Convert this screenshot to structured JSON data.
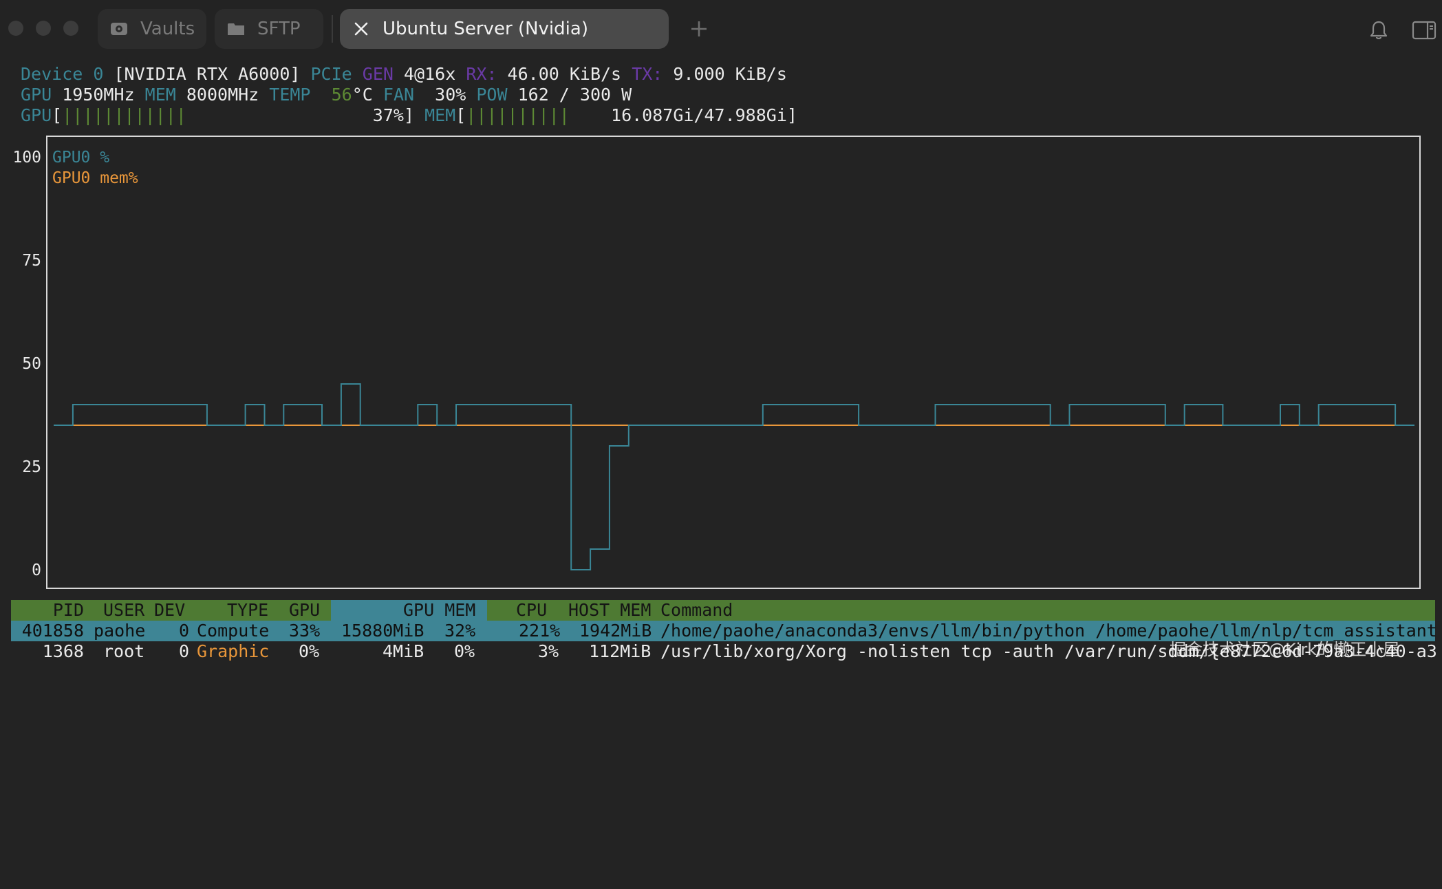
{
  "tabs": [
    {
      "label": "Vaults",
      "icon": "vault-icon"
    },
    {
      "label": "SFTP",
      "icon": "folder-icon"
    },
    {
      "label": "Ubuntu Server (Nvidia)",
      "icon": "close-icon"
    }
  ],
  "device": {
    "label": "Device",
    "index": "0",
    "name": "[NVIDIA RTX A6000]",
    "pcie_label": "PCIe",
    "gen_label": "GEN",
    "gen_value": "4@16x",
    "rx_label": "RX:",
    "rx_value": "46.00 KiB/s",
    "tx_label": "TX:",
    "tx_value": "9.000 KiB/s"
  },
  "clocks": {
    "gpu_label": "GPU",
    "gpu_value": "1950MHz",
    "mem_label": "MEM",
    "mem_value": "8000MHz",
    "temp_label": "TEMP",
    "temp_value": "56",
    "temp_unit": "°C",
    "fan_label": "FAN",
    "fan_value": "30%",
    "pow_label": "POW",
    "pow_value": "162 / 300 W"
  },
  "bars": {
    "gpu_label": "GPU",
    "gpu_bar": "||||||||||||",
    "gpu_percent": "37%",
    "gpu_fill": 0.37,
    "mem_label": "MEM",
    "mem_bar": "||||||||||",
    "mem_value": "16.087Gi/47.988Gi",
    "mem_fill": 0.335
  },
  "chart_data": {
    "type": "line",
    "ylim": [
      0,
      100
    ],
    "yticks": [
      "100",
      "75",
      "50",
      "25",
      "0"
    ],
    "series": [
      {
        "name": "GPU0 %",
        "color": "#3a8696",
        "values": [
          35,
          40,
          40,
          40,
          40,
          40,
          40,
          40,
          35,
          35,
          40,
          35,
          40,
          40,
          35,
          45,
          35,
          35,
          35,
          40,
          35,
          40,
          40,
          40,
          40,
          40,
          40,
          0,
          5,
          30,
          35,
          35,
          35,
          35,
          35,
          35,
          35,
          40,
          40,
          40,
          40,
          40,
          35,
          35,
          35,
          35,
          40,
          40,
          40,
          40,
          40,
          40,
          35,
          40,
          40,
          40,
          40,
          40,
          35,
          40,
          40,
          35,
          35,
          35,
          40,
          35,
          40,
          40,
          40,
          40,
          35
        ]
      },
      {
        "name": "GPU0 mem%",
        "color": "#e8963a",
        "values": [
          35,
          35,
          35,
          35,
          35,
          35,
          35,
          35,
          35,
          35,
          35,
          35,
          35,
          35,
          35,
          35,
          35,
          35,
          35,
          35,
          35,
          35,
          35,
          35,
          35,
          35,
          35,
          35,
          35,
          35,
          35,
          35,
          35,
          35,
          35,
          35,
          35,
          35,
          35,
          35,
          35,
          35,
          35,
          35,
          35,
          35,
          35,
          35,
          35,
          35,
          35,
          35,
          35,
          35,
          35,
          35,
          35,
          35,
          35,
          35,
          35,
          35,
          35,
          35,
          35,
          35,
          35,
          35,
          35,
          35,
          35
        ]
      }
    ]
  },
  "process_table": {
    "headers": [
      "PID",
      "USER",
      "DEV",
      "TYPE",
      "GPU",
      "GPU MEM",
      "CPU",
      "HOST MEM",
      "Command"
    ],
    "rows": [
      {
        "pid": "401858",
        "user": "paohe",
        "dev": "0",
        "type": "Compute",
        "gpu": "33%",
        "gpu_mem": "15880MiB",
        "gpu_mem_pct": "32%",
        "cpu": "221%",
        "host_mem": "1942MiB",
        "command": "/home/paohe/anaconda3/envs/llm/bin/python /home/paohe/llm/nlp/tcm_assistant"
      },
      {
        "pid": "1368",
        "user": "root",
        "dev": "0",
        "type": "Graphic",
        "gpu": "0%",
        "gpu_mem": "4MiB",
        "gpu_mem_pct": "0%",
        "cpu": "3%",
        "host_mem": "112MiB",
        "command": "/usr/lib/xorg/Xorg -nolisten tcp -auth /var/run/sddm/{e8772c6d-79a3-4c40-a3"
      }
    ]
  },
  "watermark": "掘金技术社区@Kirk的懒正小屋",
  "colors": {
    "teal": "#3a8696",
    "orange": "#e8963a",
    "green": "#5d8a34",
    "purple": "#6a3aa6",
    "header_green": "#4e7a33"
  }
}
